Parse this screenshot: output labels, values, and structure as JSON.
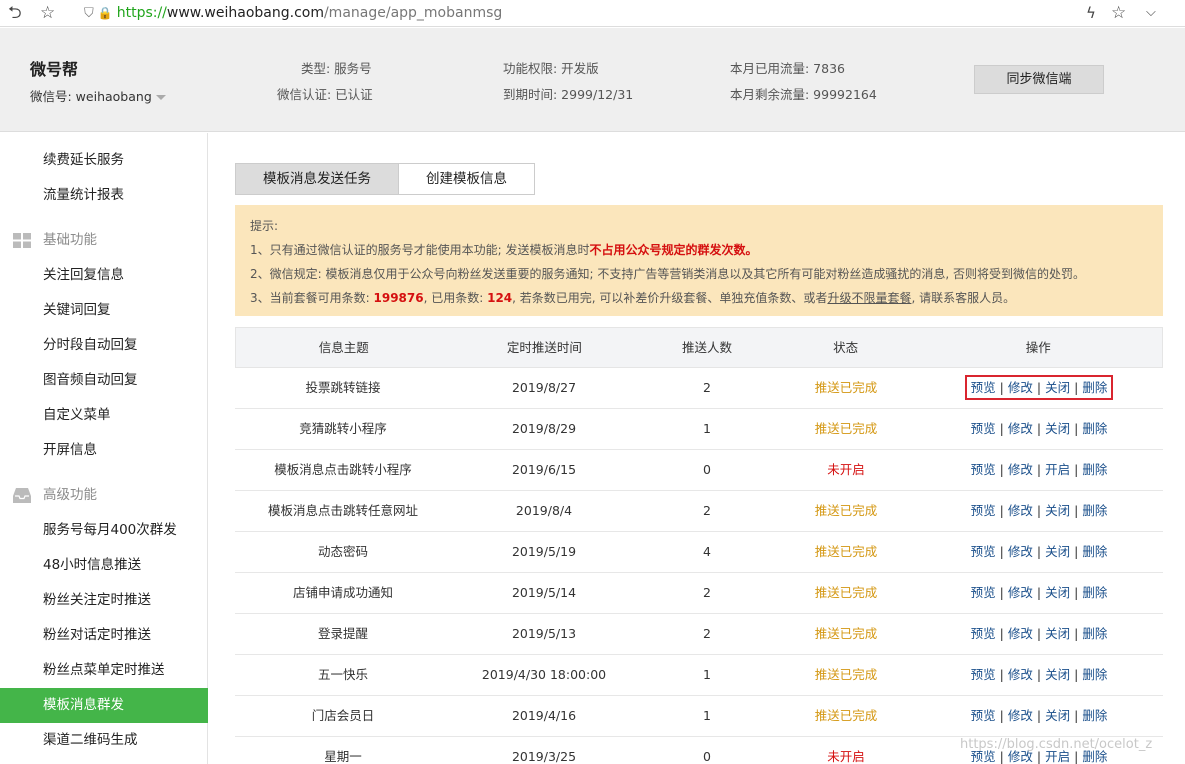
{
  "browser": {
    "url_scheme": "https://",
    "url_host": "www.weihaobang.com",
    "url_path": "/manage/app_mobanmsg"
  },
  "header": {
    "brand": "微号帮",
    "account_label": "微信号: weihaobang",
    "type": "类型: 服务号",
    "verify": "微信认证: 已认证",
    "permission": "功能权限: 开发版",
    "expire": "到期时间: 2999/12/31",
    "used_flow": "本月已用流量: 7836",
    "remain_flow": "本月剩余流量: 99992164",
    "sync_button": "同步微信端"
  },
  "sidebar": {
    "items_top": [
      "续费延长服务",
      "流量统计报表"
    ],
    "group_basic": "基础功能",
    "items_basic": [
      "关注回复信息",
      "关键词回复",
      "分时段自动回复",
      "图音频自动回复",
      "自定义菜单",
      "开屏信息"
    ],
    "group_advanced": "高级功能",
    "items_advanced": [
      "服务号每月400次群发",
      "48小时信息推送",
      "粉丝关注定时推送",
      "粉丝对话定时推送",
      "粉丝点菜单定时推送",
      "模板消息群发",
      "渠道二维码生成"
    ],
    "active": "模板消息群发"
  },
  "tabs": [
    "模板消息发送任务",
    "创建模板信息"
  ],
  "notice": {
    "title": "提示:",
    "line1_pre": "1、只有通过微信认证的服务号才能使用本功能; 发送模板消息时",
    "line1_red": "不占用公众号规定的群发次数。",
    "line2": "2、微信规定: 模板消息仅用于公众号向粉丝发送重要的服务通知; 不支持广告等营销类消息以及其它所有可能对粉丝造成骚扰的消息, 否则将受到微信的处罚。",
    "line3_a": "3、当前套餐可用条数: ",
    "line3_avail": "199876",
    "line3_b": ", 已用条数: ",
    "line3_used": "124",
    "line3_c": ", 若条数已用完, 可以补差价升级套餐、单独充值条数、或者",
    "line3_link": "升级不限量套餐",
    "line3_d": ", 请联系客服人员。"
  },
  "table": {
    "headers": [
      "信息主题",
      "定时推送时间",
      "推送人数",
      "状态",
      "操作"
    ],
    "rows": [
      {
        "subject": "投票跳转链接",
        "time": "2019/8/27",
        "count": "2",
        "status": "推送已完成",
        "toggle": "关闭"
      },
      {
        "subject": "竞猜跳转小程序",
        "time": "2019/8/29",
        "count": "1",
        "status": "推送已完成",
        "toggle": "关闭"
      },
      {
        "subject": "模板消息点击跳转小程序",
        "time": "2019/6/15",
        "count": "0",
        "status": "未开启",
        "toggle": "开启"
      },
      {
        "subject": "模板消息点击跳转任意网址",
        "time": "2019/8/4",
        "count": "2",
        "status": "推送已完成",
        "toggle": "关闭"
      },
      {
        "subject": "动态密码",
        "time": "2019/5/19",
        "count": "4",
        "status": "推送已完成",
        "toggle": "关闭"
      },
      {
        "subject": "店铺申请成功通知",
        "time": "2019/5/14",
        "count": "2",
        "status": "推送已完成",
        "toggle": "关闭"
      },
      {
        "subject": "登录提醒",
        "time": "2019/5/13",
        "count": "2",
        "status": "推送已完成",
        "toggle": "关闭"
      },
      {
        "subject": "五一快乐",
        "time": "2019/4/30 18:00:00",
        "count": "1",
        "status": "推送已完成",
        "toggle": "关闭"
      },
      {
        "subject": "门店会员日",
        "time": "2019/4/16",
        "count": "1",
        "status": "推送已完成",
        "toggle": "关闭"
      },
      {
        "subject": "星期一",
        "time": "2019/3/25",
        "count": "0",
        "status": "未开启",
        "toggle": "开启"
      }
    ],
    "op_preview": "预览",
    "op_edit": "修改",
    "op_delete": "删除"
  },
  "watermark": "https://blog.csdn.net/ocelot_z",
  "colors": {
    "accent": "#44b549",
    "status_done": "#d49711",
    "status_off": "#d51010",
    "notice_bg": "#fbe6bc",
    "highlight": "#d9252f"
  }
}
